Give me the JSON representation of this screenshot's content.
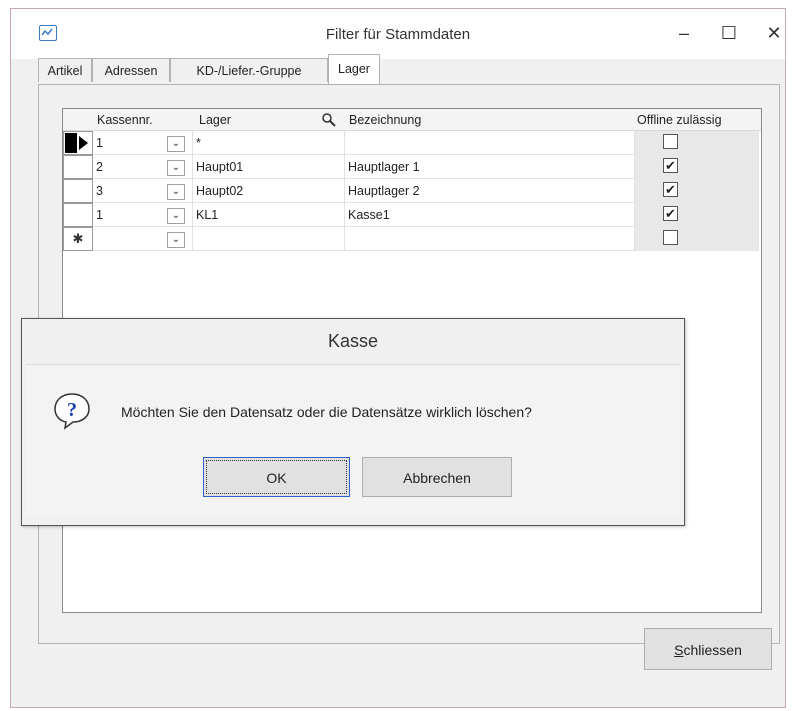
{
  "window": {
    "title": "Filter für Stammdaten"
  },
  "tabs": [
    {
      "label": "Artikel"
    },
    {
      "label": "Adressen"
    },
    {
      "label": "KD-/Liefer.-Gruppe"
    },
    {
      "label": "Lager",
      "active": true
    }
  ],
  "grid": {
    "columns": [
      "Kassennr.",
      "Lager",
      "Bezeichnung",
      "Offline zulässig"
    ],
    "rows": [
      {
        "kassennr": "1",
        "lager": "*",
        "bezeichnung": "",
        "offline": false,
        "indicator": "current"
      },
      {
        "kassennr": "2",
        "lager": "Haupt01",
        "bezeichnung": "Hauptlager 1",
        "offline": true
      },
      {
        "kassennr": "3",
        "lager": "Haupt02",
        "bezeichnung": "Hauptlager 2",
        "offline": true
      },
      {
        "kassennr": "1",
        "lager": "KL1",
        "bezeichnung": "Kasse1",
        "offline": true
      },
      {
        "kassennr": "",
        "lager": "",
        "bezeichnung": "",
        "offline": false,
        "indicator": "new"
      }
    ]
  },
  "dialog": {
    "title": "Kasse",
    "message": "Möchten Sie den Datensatz oder die Datensätze wirklich löschen?",
    "ok_label": "OK",
    "cancel_label": "Abbrechen"
  },
  "footer": {
    "close_first": "S",
    "close_rest": "chliessen"
  },
  "glyphs": {
    "check": "✔",
    "dropdown": "⌄",
    "new_row": "✱"
  },
  "colors": {
    "accent": "#2b64c8",
    "title_icon": "#3b7bc8"
  }
}
